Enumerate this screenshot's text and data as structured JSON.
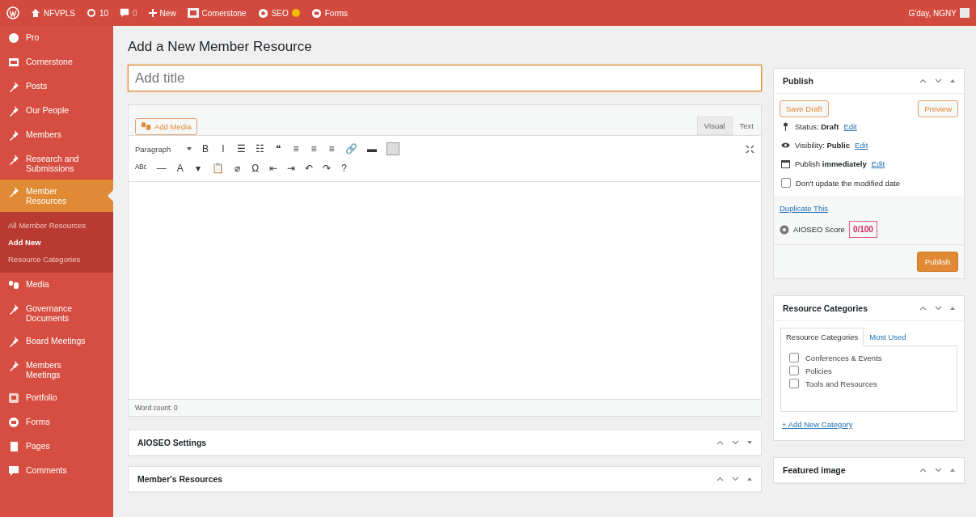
{
  "admin_bar": {
    "site": "NFVPLS",
    "updates": "10",
    "comments": "0",
    "new": "New",
    "items": [
      {
        "kind": "cornerstone",
        "label": "Cornerstone"
      },
      {
        "kind": "seo",
        "label": "SEO"
      },
      {
        "kind": "forms",
        "label": "Forms"
      }
    ],
    "greeting": "G'day, NGNY"
  },
  "sidebar": {
    "items": [
      {
        "label": "Pro",
        "kind": "hex",
        "selected": false
      },
      {
        "label": "Cornerstone",
        "kind": "cs",
        "selected": false
      },
      {
        "label": "Posts",
        "kind": "pin",
        "selected": false
      },
      {
        "label": "Our People",
        "kind": "pin",
        "selected": false
      },
      {
        "label": "Members",
        "kind": "pin",
        "selected": false
      },
      {
        "label": "Research and Submissions",
        "kind": "pin",
        "selected": false
      },
      {
        "label": "Member Resources",
        "kind": "pin",
        "selected": true,
        "children": [
          {
            "label": "All Member Resources",
            "selected": false
          },
          {
            "label": "Add New",
            "selected": true
          },
          {
            "label": "Resource Categories",
            "selected": false
          }
        ]
      },
      {
        "label": "Media",
        "kind": "media",
        "selected": false
      },
      {
        "label": "Governance Documents",
        "kind": "pin",
        "selected": false
      },
      {
        "label": "Board Meetings",
        "kind": "pin",
        "selected": false
      },
      {
        "label": "Members Meetings",
        "kind": "pin",
        "selected": false
      },
      {
        "label": "Portfolio",
        "kind": "portfolio",
        "selected": false
      },
      {
        "label": "Forms",
        "kind": "forms",
        "selected": false
      },
      {
        "label": "Pages",
        "kind": "pages",
        "selected": false
      },
      {
        "label": "Comments",
        "kind": "comments",
        "selected": false
      }
    ]
  },
  "page_title": "Add a New Member Resource",
  "title_field": {
    "placeholder": "Add title"
  },
  "editor": {
    "add_media": "Add Media",
    "tabs": [
      {
        "label": "Visual",
        "selected": true
      },
      {
        "label": "Text",
        "selected": false
      }
    ],
    "format": "Paragraph",
    "toolbar_row_1": [
      "B",
      "I",
      "☰",
      "☷",
      "❝",
      "≡",
      "≡",
      "≡",
      "🔗",
      "▬"
    ],
    "toolbar_row_2": [
      "ᴬᴮᶜ",
      "—",
      "A",
      "▾",
      "📋",
      "⌀",
      "Ω",
      "⇤",
      "⇥",
      "↶",
      "↷",
      "?"
    ],
    "word_count": "Word count: 0"
  },
  "postboxes": [
    {
      "title": "AIOSEO Settings",
      "expanded": false
    },
    {
      "title": "Member's Resources",
      "expanded": true
    }
  ],
  "publish": {
    "title": "Publish",
    "save_draft": "Save Draft",
    "preview": "Preview",
    "rows": [
      {
        "kind": "pin",
        "text": "Status: **Draft**",
        "link": "Edit"
      },
      {
        "kind": "eye",
        "text": "Visibility: **Public**",
        "link": "Edit"
      },
      {
        "kind": "calendar",
        "text": "Publish **immediately**",
        "link": "Edit"
      }
    ],
    "no_update": {
      "label": "Don't update the modified date",
      "checked": false
    },
    "duplicate": "Duplicate This",
    "score_label": "AIOSEO Score",
    "score": "0/100",
    "publish_button": "Publish"
  },
  "categories": {
    "title": "Resource Categories",
    "tabs": [
      {
        "label": "Resource Categories",
        "selected": true
      },
      {
        "label": "Most Used",
        "selected": false
      }
    ],
    "items": [
      {
        "label": "Conferences & Events",
        "checked": false
      },
      {
        "label": "Policies",
        "checked": false
      },
      {
        "label": "Tools and Resources",
        "checked": false
      }
    ],
    "add_link": "+ Add New Category"
  },
  "featured_image": {
    "title": "Featured image"
  }
}
